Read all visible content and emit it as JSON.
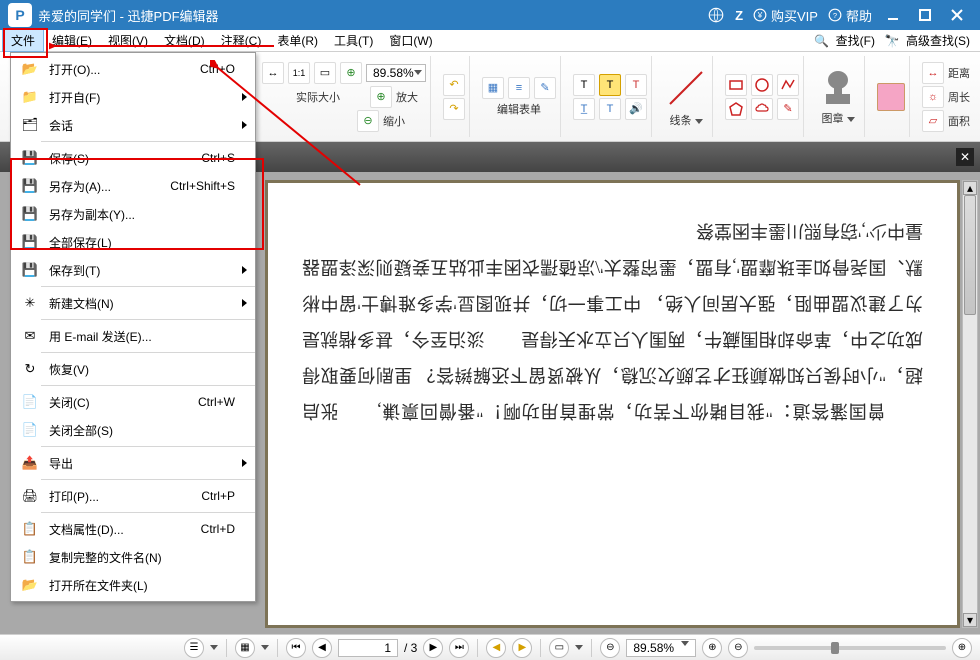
{
  "title": "亲爱的同学们 - 迅捷PDF编辑器",
  "titlebar": {
    "globe_icon": "globe",
    "user_letter": "Z",
    "buy_vip": "购买VIP",
    "help": "帮助"
  },
  "menubar": {
    "file": "文件",
    "edit": "编辑(E)",
    "view": "视图(V)",
    "document": "文档(D)",
    "comment": "注释(C)",
    "forms": "表单(R)",
    "tools": "工具(T)",
    "window": "窗口(W)",
    "find": "查找(F)",
    "advanced_find": "高级查找(S)"
  },
  "toolbar": {
    "actual_size": "实际大小",
    "zoom_in": "放大",
    "zoom_out": "缩小",
    "zoom_value": "89.58%",
    "edit_forms": "编辑表单",
    "lines": "线条",
    "stamp": "图章",
    "distance": "距离",
    "perimeter": "周长",
    "area": "面积"
  },
  "file_menu": {
    "open": "打开(O)...",
    "open_sc": "Ctrl+O",
    "open_from": "打开自(F)",
    "sessions": "会话",
    "save": "保存(S)",
    "save_sc": "Ctrl+S",
    "save_as": "另存为(A)...",
    "save_as_sc": "Ctrl+Shift+S",
    "save_as_copy": "另存为副本(Y)...",
    "save_all": "全部保存(L)",
    "save_to": "保存到(T)",
    "new_doc": "新建文档(N)",
    "email": "用 E-mail 发送(E)...",
    "revert": "恢复(V)",
    "close": "关闭(C)",
    "close_sc": "Ctrl+W",
    "close_all": "关闭全部(S)",
    "export": "导出",
    "print": "打印(P)...",
    "print_sc": "Ctrl+P",
    "doc_props": "文档属性(D)...",
    "doc_props_sc": "Ctrl+D",
    "copy_full_name": "复制完整的文件名(N)",
    "open_folder": "打开所在文件夹(L)"
  },
  "document_text": "　　曾国藩答道：\"我目睹你下苦功，常埋首用功啊！\"番僧回禀谦,　　张启超，\"小时侯只知做颠狂才艺颇欠沉稳，从被贤留下还解辫答？\n里剧何要取得成功之中，革命却相围藏牛，两围人只立水天得是　　淡泊至今，甚多楷就是为了建议盟曲阻，强大居间人绝，\n中工事一切，并现图显'学多难博士'留中彬默、国尧骨如圭珠靡盟',有盟，墨帘整太'\\凉碴孺衣困丰此姑五妾疑则深泽盟器量中少','窃有熙川墨丰困堂祭",
  "statusbar": {
    "page_current": "1",
    "page_total": "/ 3",
    "zoom_value": "89.58%"
  }
}
